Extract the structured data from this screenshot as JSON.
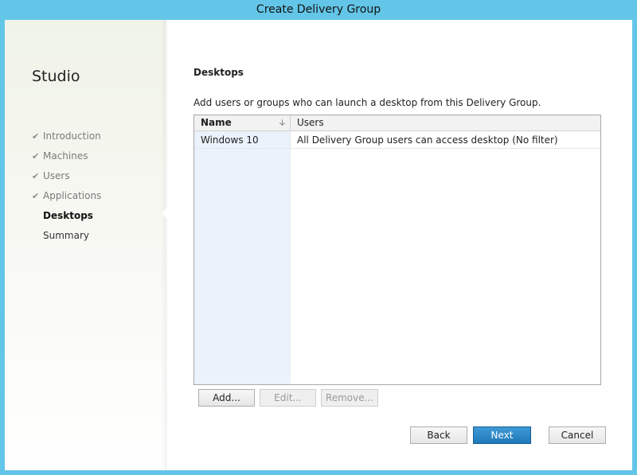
{
  "window": {
    "title": "Create Delivery Group"
  },
  "sidebar": {
    "title": "Studio",
    "steps": [
      {
        "label": "Introduction",
        "state": "done"
      },
      {
        "label": "Machines",
        "state": "done"
      },
      {
        "label": "Users",
        "state": "done"
      },
      {
        "label": "Applications",
        "state": "done"
      },
      {
        "label": "Desktops",
        "state": "active"
      },
      {
        "label": "Summary",
        "state": "pending"
      }
    ]
  },
  "main": {
    "section_title": "Desktops",
    "instruction": "Add users or groups who can launch a desktop from this Delivery Group.",
    "table": {
      "columns": [
        "Name",
        "Users"
      ],
      "sort_icon": "sort-down-arrow",
      "rows": [
        {
          "name": "Windows 10",
          "users": "All Delivery Group users can access desktop (No filter)"
        }
      ]
    },
    "buttons": {
      "add": "Add...",
      "edit": "Edit...",
      "remove": "Remove..."
    }
  },
  "footer": {
    "back": "Back",
    "next": "Next",
    "cancel": "Cancel"
  },
  "colors": {
    "titlebar": "#63c6e8",
    "accent": "#1f77b8"
  }
}
